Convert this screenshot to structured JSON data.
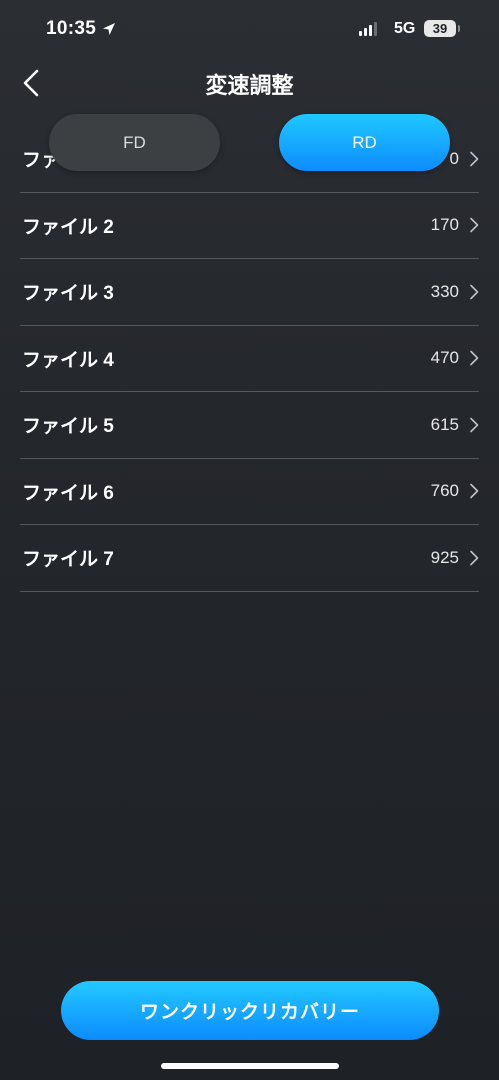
{
  "status_bar": {
    "time": "10:35",
    "network": "5G",
    "battery": "39"
  },
  "header": {
    "title": "変速調整"
  },
  "toggle": {
    "fd_label": "FD",
    "rd_label": "RD",
    "selected": "RD"
  },
  "files": [
    {
      "label": "ファイル 1",
      "value": "0"
    },
    {
      "label": "ファイル 2",
      "value": "170"
    },
    {
      "label": "ファイル 3",
      "value": "330"
    },
    {
      "label": "ファイル 4",
      "value": "470"
    },
    {
      "label": "ファイル 5",
      "value": "615"
    },
    {
      "label": "ファイル 6",
      "value": "760"
    },
    {
      "label": "ファイル 7",
      "value": "925"
    }
  ],
  "footer": {
    "recover_label": "ワンクリックリカバリー"
  },
  "icons": {
    "back": "chevron-left-icon",
    "row": "chevron-right-icon",
    "location": "location-arrow-icon"
  },
  "colors": {
    "accent_top": "#1fc8ff",
    "accent_bottom": "#0e8cff",
    "background": "#26292e"
  }
}
